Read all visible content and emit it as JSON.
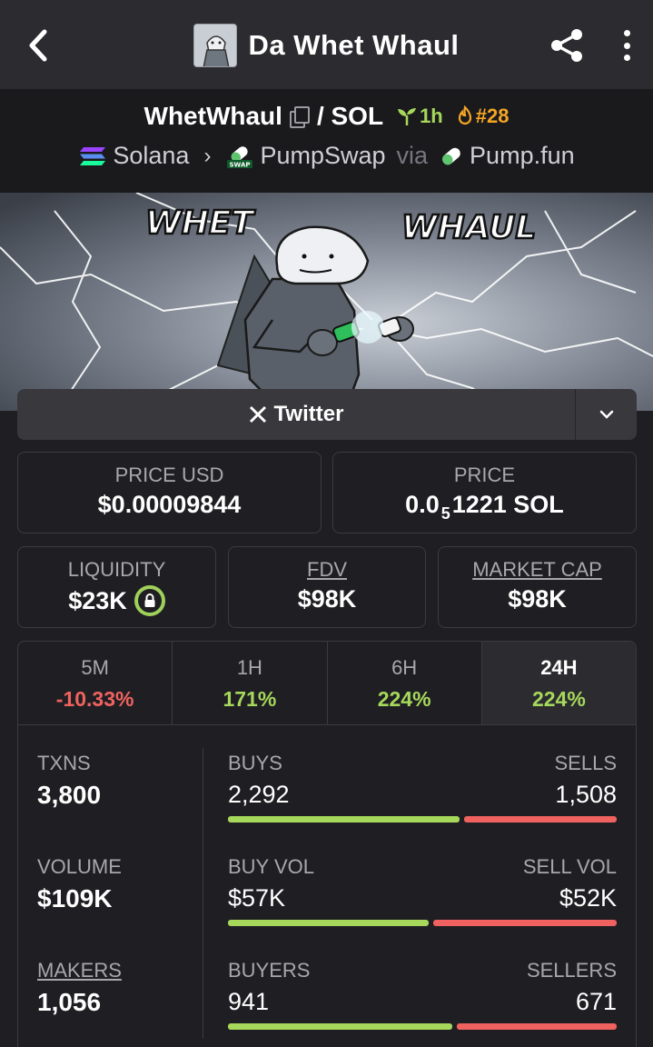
{
  "header": {
    "title": "Da Whet Whaul"
  },
  "pair": {
    "base": "WhetWhaul",
    "quote": "/ SOL",
    "age": "1h",
    "rank": "#28",
    "chain": "Solana",
    "dex": "PumpSwap",
    "via_label": "via",
    "launchpad": "Pump.fun",
    "swap_badge": "SWAP"
  },
  "banner": {
    "word1": "WHET",
    "word2": "WHAUL"
  },
  "social": {
    "twitter_label": "Twitter"
  },
  "price": {
    "usd_label": "PRICE USD",
    "usd_value": "$0.00009844",
    "native_label": "PRICE",
    "native_prefix": "0.0",
    "native_zeros": "5",
    "native_rest": "1221 SOL"
  },
  "metrics_top": {
    "liquidity_label": "LIQUIDITY",
    "liquidity_value": "$23K",
    "fdv_label": "FDV",
    "fdv_value": "$98K",
    "mcap_label": "MARKET CAP",
    "mcap_value": "$98K"
  },
  "tabs": [
    {
      "label": "5M",
      "value": "-10.33%"
    },
    {
      "label": "1H",
      "value": "171%"
    },
    {
      "label": "6H",
      "value": "224%"
    },
    {
      "label": "24H",
      "value": "224%"
    }
  ],
  "txns": {
    "label": "TXNS",
    "value": "3,800",
    "buys_label": "BUYS",
    "buys": "2,292",
    "sells_label": "SELLS",
    "sells": "1,508",
    "buy_share": 0.603
  },
  "volume": {
    "label": "VOLUME",
    "value": "$109K",
    "buy_label": "BUY VOL",
    "buy": "$57K",
    "sell_label": "SELL VOL",
    "sell": "$52K",
    "buy_share": 0.523
  },
  "makers": {
    "label": "MAKERS",
    "value": "1,056",
    "buyers_label": "BUYERS",
    "buyers": "941",
    "sellers_label": "SELLERS",
    "sellers": "671",
    "buy_share": 0.584
  },
  "colors": {
    "positive": "#a6d85b",
    "negative": "#f0625f",
    "rank": "#f5a524"
  }
}
